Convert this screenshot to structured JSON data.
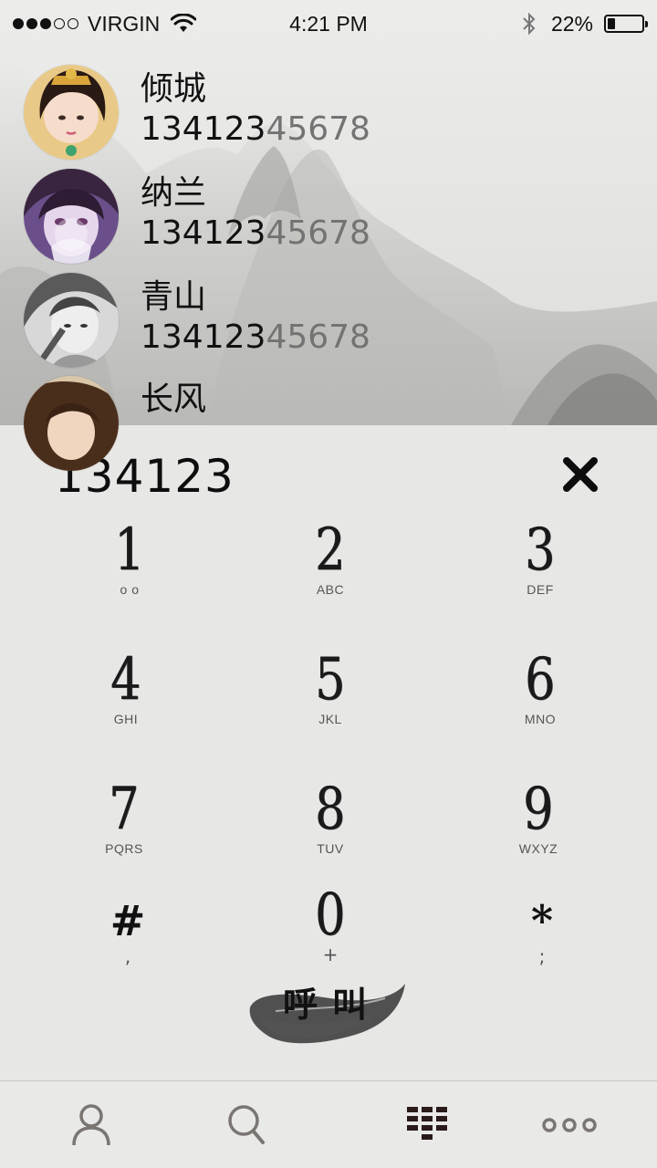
{
  "status_bar": {
    "carrier": "VIRGIN",
    "signal_bars_filled": 3,
    "signal_bars_total": 5,
    "time": "4:21 PM",
    "battery": "22%",
    "battery_level": 0.22,
    "icons": [
      "wifi-icon",
      "bluetooth-icon",
      "battery-icon"
    ]
  },
  "contacts": [
    {
      "name": "倾城",
      "number_match": "134123",
      "number_rest": "45678"
    },
    {
      "name": "纳兰",
      "number_match": "134123",
      "number_rest": "45678"
    },
    {
      "name": "青山",
      "number_match": "134123",
      "number_rest": "45678"
    },
    {
      "name": "长风",
      "number_match": "",
      "number_rest": ""
    }
  ],
  "dialer": {
    "input_value": "134123",
    "delete_icon": "close-icon",
    "keys": [
      {
        "digit": "1",
        "letters": "o o"
      },
      {
        "digit": "2",
        "letters": "ABC"
      },
      {
        "digit": "3",
        "letters": "DEF"
      },
      {
        "digit": "4",
        "letters": "GHI"
      },
      {
        "digit": "5",
        "letters": "JKL"
      },
      {
        "digit": "6",
        "letters": "MNO"
      },
      {
        "digit": "7",
        "letters": "PQRS"
      },
      {
        "digit": "8",
        "letters": "TUV"
      },
      {
        "digit": "9",
        "letters": "WXYZ"
      },
      {
        "digit": "#",
        "letters": ","
      },
      {
        "digit": "0",
        "letters": "+"
      },
      {
        "digit": "*",
        "letters": ";"
      }
    ],
    "call_label": "呼叫"
  },
  "tabbar": {
    "tabs": [
      {
        "icon": "person-icon",
        "active": false
      },
      {
        "icon": "search-icon",
        "active": false
      },
      {
        "icon": "keypad-icon",
        "active": true
      },
      {
        "icon": "more-icon",
        "active": false
      }
    ]
  },
  "colors": {
    "background": "#e6e6e4",
    "text": "#111111",
    "number_rest": "#737373",
    "icon_inactive": "#7a7672",
    "icon_active": "#2a1a1a"
  }
}
